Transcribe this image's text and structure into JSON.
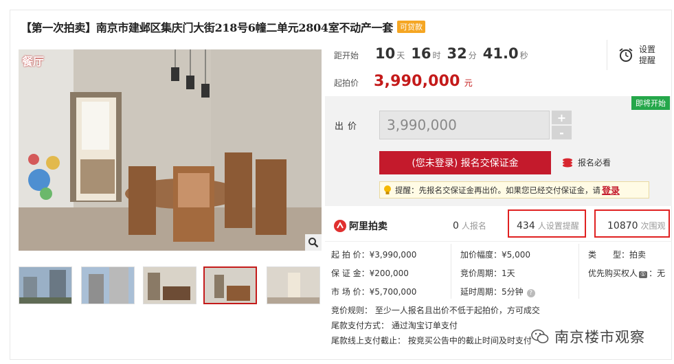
{
  "title": "【第一次拍卖】南京市建邺区集庆门大街218号6幢二单元2804室不动产一套",
  "loan_tag": "可贷款",
  "room_label": "餐厅",
  "countdown": {
    "label": "距开始",
    "days": "10",
    "days_unit": "天",
    "hours": "16",
    "hours_unit": "时",
    "minutes": "32",
    "minutes_unit": "分",
    "seconds": "41.0",
    "seconds_unit": "秒"
  },
  "reminder": {
    "label": "设置提醒",
    "icon": "alarm-clock-icon"
  },
  "start_price": {
    "label": "起拍价",
    "value": "3,990,000",
    "unit": "元"
  },
  "status_tag": "即将开始",
  "bid": {
    "label": "出价",
    "value": "3,990,000",
    "plus": "+",
    "minus": "-",
    "button": "(您未登录) 报名交保证金",
    "must_read": "报名必看",
    "tip_text": "提醒：先报名交保证金再出价。如果您已经交付保证金，请",
    "tip_link": "登录"
  },
  "stats": {
    "logo_text": "阿里拍卖",
    "signups": "0",
    "signups_label": "人报名",
    "reminders": "434",
    "reminders_label": "人设置提醒",
    "views": "10870",
    "views_label": "次围观"
  },
  "info": {
    "start_price": "起 拍 价：¥3,990,000",
    "deposit": "保 证 金：¥200,000",
    "market_price": "市 场 价：¥5,700,000",
    "increment": "加价幅度：¥5,000",
    "cycle": "竞价周期：1天",
    "extension": "延时周期：5分钟",
    "type_key": "类　　型：",
    "type_val": "拍卖",
    "priority_key": "优先购买权人",
    "priority_badge": "①",
    "priority_val": "：无"
  },
  "rules": {
    "bid_rule": "竞价规则：  至少一人报名且出价不低于起拍价，方可成交",
    "payment": "尾款支付方式：  通过淘宝订单支付",
    "deadline": "尾款线上支付截止：  按竞买公告中的截止时间及时支付"
  },
  "watermark": "南京楼市观察",
  "colors": {
    "accent_red": "#c41a2c",
    "green": "#25a74a",
    "orange": "#f5a623"
  }
}
